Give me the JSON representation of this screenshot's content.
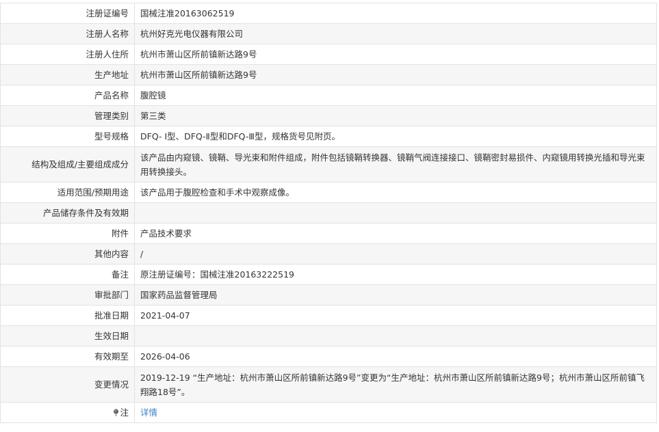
{
  "rows": [
    {
      "label": "注册证编号",
      "value": "国械注准20163062519"
    },
    {
      "label": "注册人名称",
      "value": "杭州好克光电仪器有限公司"
    },
    {
      "label": "注册人住所",
      "value": "杭州市萧山区所前镇新达路9号"
    },
    {
      "label": "生产地址",
      "value": "杭州市萧山区所前镇新达路9号"
    },
    {
      "label": "产品名称",
      "value": "腹腔镜"
    },
    {
      "label": "管理类别",
      "value": "第三类"
    },
    {
      "label": "型号规格",
      "value": "DFQ- Ⅰ型、DFQ-Ⅱ型和DFQ-Ⅲ型，规格货号见附页。"
    },
    {
      "label": "结构及组成/主要组成成分",
      "value": "该产品由内窥镜、镜鞘、导光束和附件组成，附件包括镜鞘转换器、镜鞘气阀连接接口、镜鞘密封易损件、内窥镜用转换光插和导光束用转换接头。"
    },
    {
      "label": "适用范围/预期用途",
      "value": "该产品用于腹腔检查和手术中观察成像。"
    },
    {
      "label": "产品储存条件及有效期",
      "value": ""
    },
    {
      "label": "附件",
      "value": "产品技术要求"
    },
    {
      "label": "其他内容",
      "value": "/"
    },
    {
      "label": "备注",
      "value": "原注册证编号：国械注准20163222519"
    },
    {
      "label": "审批部门",
      "value": "国家药品监督管理局"
    },
    {
      "label": "批准日期",
      "value": "2021-04-07"
    },
    {
      "label": "生效日期",
      "value": ""
    },
    {
      "label": "有效期至",
      "value": "2026-04-06"
    },
    {
      "label": "变更情况",
      "value": "2019-12-19 “生产地址：杭州市萧山区所前镇新达路9号”变更为“生产地址：杭州市萧山区所前镇新达路9号；杭州市萧山区所前镇飞翔路18号”。"
    }
  ],
  "note": {
    "label": "注",
    "link_text": "详情",
    "icon": "pin-icon"
  }
}
